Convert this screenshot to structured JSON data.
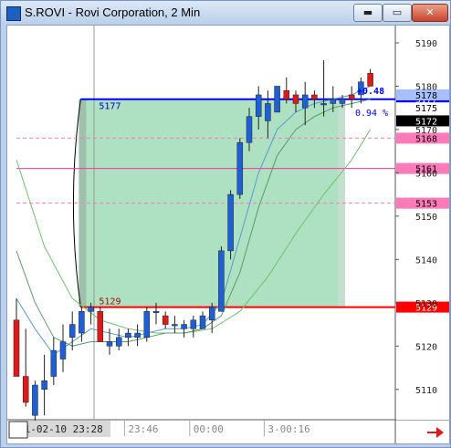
{
  "window": {
    "title": "S.ROVI - Rovi Corporation, 2 Min",
    "buttons": {
      "minimize": "▬",
      "restore": "▭",
      "close": "✕"
    }
  },
  "chart_data": {
    "type": "candlestick",
    "ylim": [
      5103,
      5194
    ],
    "y_ticks": [
      5110,
      5120,
      5130,
      5140,
      5150,
      5160,
      5170,
      5180,
      5190
    ],
    "x_labels": [
      {
        "label": "11-02-10  23:28",
        "index": 0,
        "highlight": true
      },
      {
        "label": "23:46",
        "index": 12,
        "highlight": false
      },
      {
        "label": "00:00",
        "index": 19,
        "highlight": false
      },
      {
        "label": "3-00:16",
        "index": 27,
        "highlight": false
      }
    ],
    "candles": [
      {
        "o": 5126,
        "h": 5131,
        "l": 5113,
        "c": 5113
      },
      {
        "o": 5113,
        "h": 5124,
        "l": 5106,
        "c": 5107
      },
      {
        "o": 5104,
        "h": 5112,
        "l": 5102,
        "c": 5111
      },
      {
        "o": 5110,
        "h": 5118,
        "l": 5104,
        "c": 5112
      },
      {
        "o": 5113,
        "h": 5122,
        "l": 5111,
        "c": 5119
      },
      {
        "o": 5117,
        "h": 5125,
        "l": 5114,
        "c": 5121
      },
      {
        "o": 5122,
        "h": 5128,
        "l": 5119,
        "c": 5125
      },
      {
        "o": 5123,
        "h": 5129,
        "l": 5121,
        "c": 5128
      },
      {
        "o": 5128,
        "h": 5130,
        "l": 5125,
        "c": 5129
      },
      {
        "o": 5128,
        "h": 5129,
        "l": 5121,
        "c": 5121
      },
      {
        "o": 5120,
        "h": 5124,
        "l": 5118,
        "c": 5121
      },
      {
        "o": 5120,
        "h": 5124,
        "l": 5119,
        "c": 5122
      },
      {
        "o": 5122,
        "h": 5124,
        "l": 5120,
        "c": 5123
      },
      {
        "o": 5122,
        "h": 5125,
        "l": 5120,
        "c": 5123
      },
      {
        "o": 5122,
        "h": 5129,
        "l": 5121,
        "c": 5128
      },
      {
        "o": 5128,
        "h": 5130,
        "l": 5125,
        "c": 5128
      },
      {
        "o": 5127,
        "h": 5128,
        "l": 5124,
        "c": 5125
      },
      {
        "o": 5125,
        "h": 5127,
        "l": 5123,
        "c": 5125
      },
      {
        "o": 5124,
        "h": 5126,
        "l": 5122,
        "c": 5125
      },
      {
        "o": 5124,
        "h": 5127,
        "l": 5122,
        "c": 5126
      },
      {
        "o": 5124,
        "h": 5128,
        "l": 5124,
        "c": 5127
      },
      {
        "o": 5126,
        "h": 5130,
        "l": 5123,
        "c": 5129
      },
      {
        "o": 5128,
        "h": 5143,
        "l": 5128,
        "c": 5142
      },
      {
        "o": 5142,
        "h": 5156,
        "l": 5140,
        "c": 5155
      },
      {
        "o": 5155,
        "h": 5168,
        "l": 5154,
        "c": 5167
      },
      {
        "o": 5167,
        "h": 5175,
        "l": 5165,
        "c": 5173
      },
      {
        "o": 5173,
        "h": 5180,
        "l": 5170,
        "c": 5178
      },
      {
        "o": 5172,
        "h": 5179,
        "l": 5168,
        "c": 5176
      },
      {
        "o": 5174,
        "h": 5180,
        "l": 5174,
        "c": 5180
      },
      {
        "o": 5179,
        "h": 5182,
        "l": 5176,
        "c": 5177
      },
      {
        "o": 5178,
        "h": 5179,
        "l": 5174,
        "c": 5176
      },
      {
        "o": 5175,
        "h": 5181,
        "l": 5171,
        "c": 5178
      },
      {
        "o": 5178,
        "h": 5179,
        "l": 5175,
        "c": 5177
      },
      {
        "o": 5176,
        "h": 5186,
        "l": 5173,
        "c": 5176
      },
      {
        "o": 5176,
        "h": 5180,
        "l": 5174,
        "c": 5177
      },
      {
        "o": 5176,
        "h": 5178,
        "l": 5175,
        "c": 5177
      },
      {
        "o": 5178,
        "h": 5180,
        "l": 5175,
        "c": 5177
      },
      {
        "o": 5178,
        "h": 5182,
        "l": 5176,
        "c": 5181
      },
      {
        "o": 5183,
        "h": 5184,
        "l": 5180,
        "c": 5180
      }
    ],
    "ma_fast": [
      [
        0,
        5131
      ],
      [
        2,
        5124
      ],
      [
        4,
        5118
      ],
      [
        6,
        5121
      ],
      [
        8,
        5124
      ],
      [
        10,
        5123
      ],
      [
        12,
        5122
      ],
      [
        14,
        5123
      ],
      [
        16,
        5124
      ],
      [
        18,
        5124
      ],
      [
        20,
        5125
      ],
      [
        22,
        5130
      ],
      [
        24,
        5145
      ],
      [
        26,
        5160
      ],
      [
        28,
        5170
      ],
      [
        30,
        5174
      ],
      [
        32,
        5176
      ],
      [
        34,
        5177
      ],
      [
        36,
        5178
      ],
      [
        38,
        5180
      ]
    ],
    "ma_slow": [
      [
        0,
        5142
      ],
      [
        2,
        5130
      ],
      [
        4,
        5122
      ],
      [
        6,
        5120
      ],
      [
        8,
        5121
      ],
      [
        10,
        5121
      ],
      [
        12,
        5121
      ],
      [
        14,
        5122
      ],
      [
        16,
        5123
      ],
      [
        18,
        5123
      ],
      [
        20,
        5124
      ],
      [
        22,
        5127
      ],
      [
        24,
        5137
      ],
      [
        26,
        5152
      ],
      [
        28,
        5164
      ],
      [
        30,
        5170
      ],
      [
        32,
        5173
      ],
      [
        34,
        5175
      ],
      [
        36,
        5176
      ],
      [
        38,
        5177
      ]
    ],
    "ma_long": [
      [
        0,
        5163
      ],
      [
        3,
        5143
      ],
      [
        6,
        5131
      ],
      [
        9,
        5126
      ],
      [
        12,
        5124
      ],
      [
        15,
        5123
      ],
      [
        18,
        5123
      ],
      [
        21,
        5124
      ],
      [
        24,
        5128
      ],
      [
        27,
        5136
      ],
      [
        30,
        5146
      ],
      [
        33,
        5155
      ],
      [
        36,
        5163
      ],
      [
        38,
        5170
      ]
    ],
    "zone": {
      "from_index": 7,
      "to_index": 35,
      "low": 5129,
      "high": 5177,
      "low_label": "5129",
      "high_label": "5177"
    },
    "levels": [
      {
        "value": 5177,
        "color": "#0000ff",
        "style": "solid",
        "label": "5177",
        "tag_bg": "#0000ff",
        "tag_fg": "#ffffff"
      },
      {
        "value": 5129,
        "color": "#ff0000",
        "style": "solid",
        "label": "5129",
        "tag_bg": "#ff0000",
        "tag_fg": "#ffffff"
      },
      {
        "value": 5168,
        "color": "#ff7ab8",
        "style": "dashed",
        "label": "5168",
        "tag_bg": "#ff7ab8",
        "tag_fg": "#000000"
      },
      {
        "value": 5161,
        "color": "#ff3399",
        "style": "solid",
        "label": "5161",
        "tag_bg": "#ff7ab8",
        "tag_fg": "#000000"
      },
      {
        "value": 5153,
        "color": "#ff7ab8",
        "style": "dashed",
        "label": "5153",
        "tag_bg": "#ff7ab8",
        "tag_fg": "#000000"
      }
    ],
    "price_tags": [
      {
        "value": 5178,
        "label": "5178",
        "bg": "#a7c0ff",
        "fg": "#000000"
      },
      {
        "value": 5175,
        "label": "5175",
        "bg": "#ffffff",
        "fg": "#000000"
      },
      {
        "value": 5172,
        "label": "5172",
        "bg": "#000000",
        "fg": "#ffffff"
      }
    ],
    "change_label": "+0.48",
    "change_pct": "0.94 %",
    "colors": {
      "up": "#1f5fd6",
      "down": "#e01818",
      "zone": "#9fdcb6",
      "ma_fast": "#5a9ad0",
      "ma_slow": "#5a9a6a",
      "ma_long": "#6ec06e"
    }
  }
}
